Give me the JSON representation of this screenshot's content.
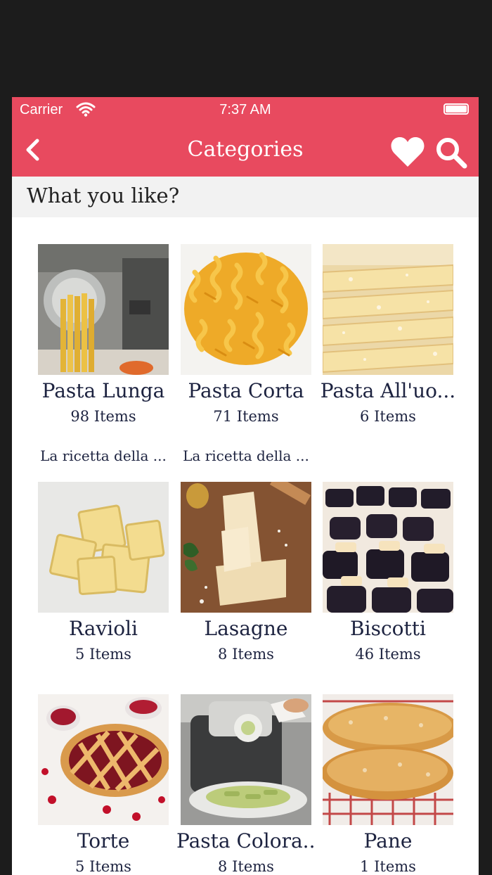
{
  "status_bar": {
    "carrier": "Carrier",
    "time": "7:37 AM"
  },
  "nav": {
    "title": "Categories"
  },
  "subheader": {
    "text": "What you like?"
  },
  "categories": [
    {
      "title": "Pasta Lunga",
      "count": "98 Items",
      "description": "La ricetta della ..."
    },
    {
      "title": "Pasta Corta",
      "count": "71 Items",
      "description": "La ricetta della ..."
    },
    {
      "title": "Pasta All'uo...",
      "count": "6 Items",
      "description": ""
    },
    {
      "title": "Ravioli",
      "count": "5 Items",
      "description": ""
    },
    {
      "title": "Lasagne",
      "count": "8 Items",
      "description": ""
    },
    {
      "title": "Biscotti",
      "count": "46 Items",
      "description": ""
    },
    {
      "title": "Torte",
      "count": "5 Items",
      "description": ""
    },
    {
      "title": "Pasta Colora...",
      "count": "8 Items",
      "description": ""
    },
    {
      "title": "Pane",
      "count": "1 Items",
      "description": ""
    }
  ],
  "colors": {
    "accent": "#e84a5f",
    "text": "#1d2340",
    "subheader_bg": "#f2f2f2"
  },
  "icons": [
    "wifi-icon",
    "battery-icon",
    "back-icon",
    "heart-icon",
    "search-icon"
  ]
}
